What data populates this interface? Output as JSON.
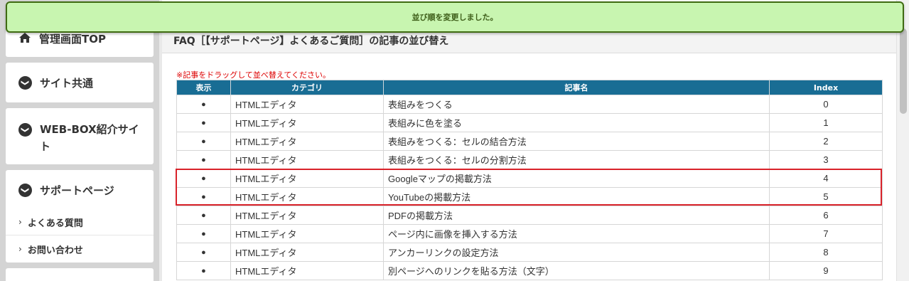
{
  "flash": {
    "message": "並び順を変更しました。"
  },
  "sidebar": {
    "home_label": "管理画面TOP",
    "sections": [
      {
        "label": "サイト共通"
      },
      {
        "label": "WEB-BOX紹介サイト"
      },
      {
        "label": "サポートページ"
      }
    ],
    "sub_items": [
      {
        "label": "よくある質問"
      },
      {
        "label": "お問い合わせ"
      }
    ],
    "chevron_glyph": "❯",
    "caret_glyph": "›"
  },
  "main": {
    "title": "FAQ［【サポートページ】よくあるご質問］の記事の並び替え",
    "notice": "※記事をドラッグして並べ替えてください。",
    "table": {
      "headers": {
        "display": "表示",
        "category": "カテゴリ",
        "article": "記事名",
        "index": "Index"
      },
      "rows": [
        {
          "display": "●",
          "category": "HTMLエディタ",
          "article": "表組みをつくる",
          "index": "0"
        },
        {
          "display": "●",
          "category": "HTMLエディタ",
          "article": "表組みに色を塗る",
          "index": "1"
        },
        {
          "display": "●",
          "category": "HTMLエディタ",
          "article": "表組みをつくる：セルの結合方法",
          "index": "2"
        },
        {
          "display": "●",
          "category": "HTMLエディタ",
          "article": "表組みをつくる：セルの分割方法",
          "index": "3"
        },
        {
          "display": "●",
          "category": "HTMLエディタ",
          "article": "Googleマップの掲載方法",
          "index": "4"
        },
        {
          "display": "●",
          "category": "HTMLエディタ",
          "article": "YouTubeの掲載方法",
          "index": "5"
        },
        {
          "display": "●",
          "category": "HTMLエディタ",
          "article": "PDFの掲載方法",
          "index": "6"
        },
        {
          "display": "●",
          "category": "HTMLエディタ",
          "article": "ページ内に画像を挿入する方法",
          "index": "7"
        },
        {
          "display": "●",
          "category": "HTMLエディタ",
          "article": "アンカーリンクの設定方法",
          "index": "8"
        },
        {
          "display": "●",
          "category": "HTMLエディタ",
          "article": "別ページへのリンクを貼る方法（文字）",
          "index": "9"
        }
      ]
    }
  },
  "colors": {
    "header_blue": "#196d94",
    "flash_bg": "#c8f5b0",
    "flash_border": "#3f6b12",
    "highlight_red": "#d9222a",
    "notice_red": "#dd0000"
  }
}
